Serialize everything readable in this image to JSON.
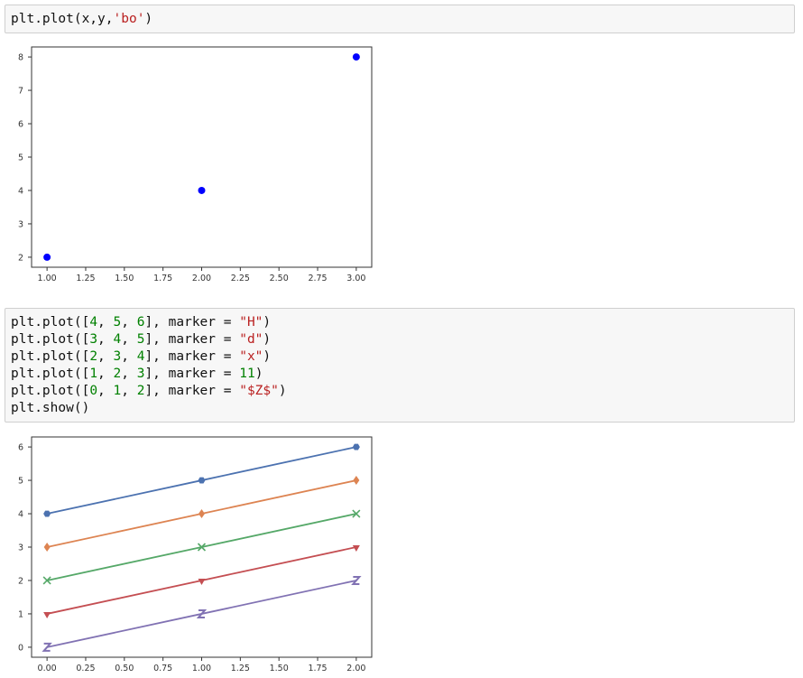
{
  "cells": [
    {
      "lines": [
        [
          {
            "t": "plt.plot(x,y,",
            "c": ""
          },
          {
            "t": "'bo'",
            "c": "str"
          },
          {
            "t": ")",
            "c": ""
          }
        ]
      ]
    },
    {
      "lines": [
        [
          {
            "t": "plt.plot([",
            "c": ""
          },
          {
            "t": "4",
            "c": "num"
          },
          {
            "t": ", ",
            "c": ""
          },
          {
            "t": "5",
            "c": "num"
          },
          {
            "t": ", ",
            "c": ""
          },
          {
            "t": "6",
            "c": "num"
          },
          {
            "t": "], marker = ",
            "c": ""
          },
          {
            "t": "\"H\"",
            "c": "str"
          },
          {
            "t": ")",
            "c": ""
          }
        ],
        [
          {
            "t": "plt.plot([",
            "c": ""
          },
          {
            "t": "3",
            "c": "num"
          },
          {
            "t": ", ",
            "c": ""
          },
          {
            "t": "4",
            "c": "num"
          },
          {
            "t": ", ",
            "c": ""
          },
          {
            "t": "5",
            "c": "num"
          },
          {
            "t": "], marker = ",
            "c": ""
          },
          {
            "t": "\"d\"",
            "c": "str"
          },
          {
            "t": ")",
            "c": ""
          }
        ],
        [
          {
            "t": "plt.plot([",
            "c": ""
          },
          {
            "t": "2",
            "c": "num"
          },
          {
            "t": ", ",
            "c": ""
          },
          {
            "t": "3",
            "c": "num"
          },
          {
            "t": ", ",
            "c": ""
          },
          {
            "t": "4",
            "c": "num"
          },
          {
            "t": "], marker = ",
            "c": ""
          },
          {
            "t": "\"x\"",
            "c": "str"
          },
          {
            "t": ")",
            "c": ""
          }
        ],
        [
          {
            "t": "plt.plot([",
            "c": ""
          },
          {
            "t": "1",
            "c": "num"
          },
          {
            "t": ", ",
            "c": ""
          },
          {
            "t": "2",
            "c": "num"
          },
          {
            "t": ", ",
            "c": ""
          },
          {
            "t": "3",
            "c": "num"
          },
          {
            "t": "], marker = ",
            "c": ""
          },
          {
            "t": "11",
            "c": "num"
          },
          {
            "t": ")",
            "c": ""
          }
        ],
        [
          {
            "t": "plt.plot([",
            "c": ""
          },
          {
            "t": "0",
            "c": "num"
          },
          {
            "t": ", ",
            "c": ""
          },
          {
            "t": "1",
            "c": "num"
          },
          {
            "t": ", ",
            "c": ""
          },
          {
            "t": "2",
            "c": "num"
          },
          {
            "t": "], marker = ",
            "c": ""
          },
          {
            "t": "\"$Z$\"",
            "c": "str"
          },
          {
            "t": ")",
            "c": ""
          }
        ],
        [
          {
            "t": "plt.show()",
            "c": ""
          }
        ]
      ]
    }
  ],
  "colors": {
    "str": "#ba2121",
    "num": "#008000"
  },
  "chart_data": [
    {
      "type": "scatter",
      "title": "",
      "xlabel": "",
      "ylabel": "",
      "xlim": [
        0.9,
        3.1
      ],
      "ylim": [
        1.7,
        8.3
      ],
      "xticks": [
        1.0,
        1.25,
        1.5,
        1.75,
        2.0,
        2.25,
        2.5,
        2.75,
        3.0
      ],
      "xtick_labels": [
        "1.00",
        "1.25",
        "1.50",
        "1.75",
        "2.00",
        "2.25",
        "2.50",
        "2.75",
        "3.00"
      ],
      "yticks": [
        2,
        3,
        4,
        5,
        6,
        7,
        8
      ],
      "ytick_labels": [
        "2",
        "3",
        "4",
        "5",
        "6",
        "7",
        "8"
      ],
      "grid": false,
      "series": [
        {
          "x": [
            1,
            2,
            3
          ],
          "y": [
            2,
            4,
            8
          ],
          "color": "#0000ff",
          "marker": "circle",
          "line": false
        }
      ]
    },
    {
      "type": "line",
      "title": "",
      "xlabel": "",
      "ylabel": "",
      "xlim": [
        -0.1,
        2.1
      ],
      "ylim": [
        -0.3,
        6.3
      ],
      "xticks": [
        0,
        0.25,
        0.5,
        0.75,
        1.0,
        1.25,
        1.5,
        1.75,
        2.0
      ],
      "xtick_labels": [
        "0.00",
        "0.25",
        "0.50",
        "0.75",
        "1.00",
        "1.25",
        "1.50",
        "1.75",
        "2.00"
      ],
      "yticks": [
        0,
        1,
        2,
        3,
        4,
        5,
        6
      ],
      "ytick_labels": [
        "0",
        "1",
        "2",
        "3",
        "4",
        "5",
        "6"
      ],
      "grid": false,
      "series": [
        {
          "x": [
            0,
            1,
            2
          ],
          "y": [
            4,
            5,
            6
          ],
          "color": "#4c72b0",
          "marker": "H",
          "line": true
        },
        {
          "x": [
            0,
            1,
            2
          ],
          "y": [
            3,
            4,
            5
          ],
          "color": "#dd8452",
          "marker": "d",
          "line": true
        },
        {
          "x": [
            0,
            1,
            2
          ],
          "y": [
            2,
            3,
            4
          ],
          "color": "#55a868",
          "marker": "x",
          "line": true
        },
        {
          "x": [
            0,
            1,
            2
          ],
          "y": [
            1,
            2,
            3
          ],
          "color": "#c44e52",
          "marker": "caretdown",
          "line": true
        },
        {
          "x": [
            0,
            1,
            2
          ],
          "y": [
            0,
            1,
            2
          ],
          "color": "#8172b3",
          "marker": "Z",
          "line": true
        }
      ]
    }
  ]
}
